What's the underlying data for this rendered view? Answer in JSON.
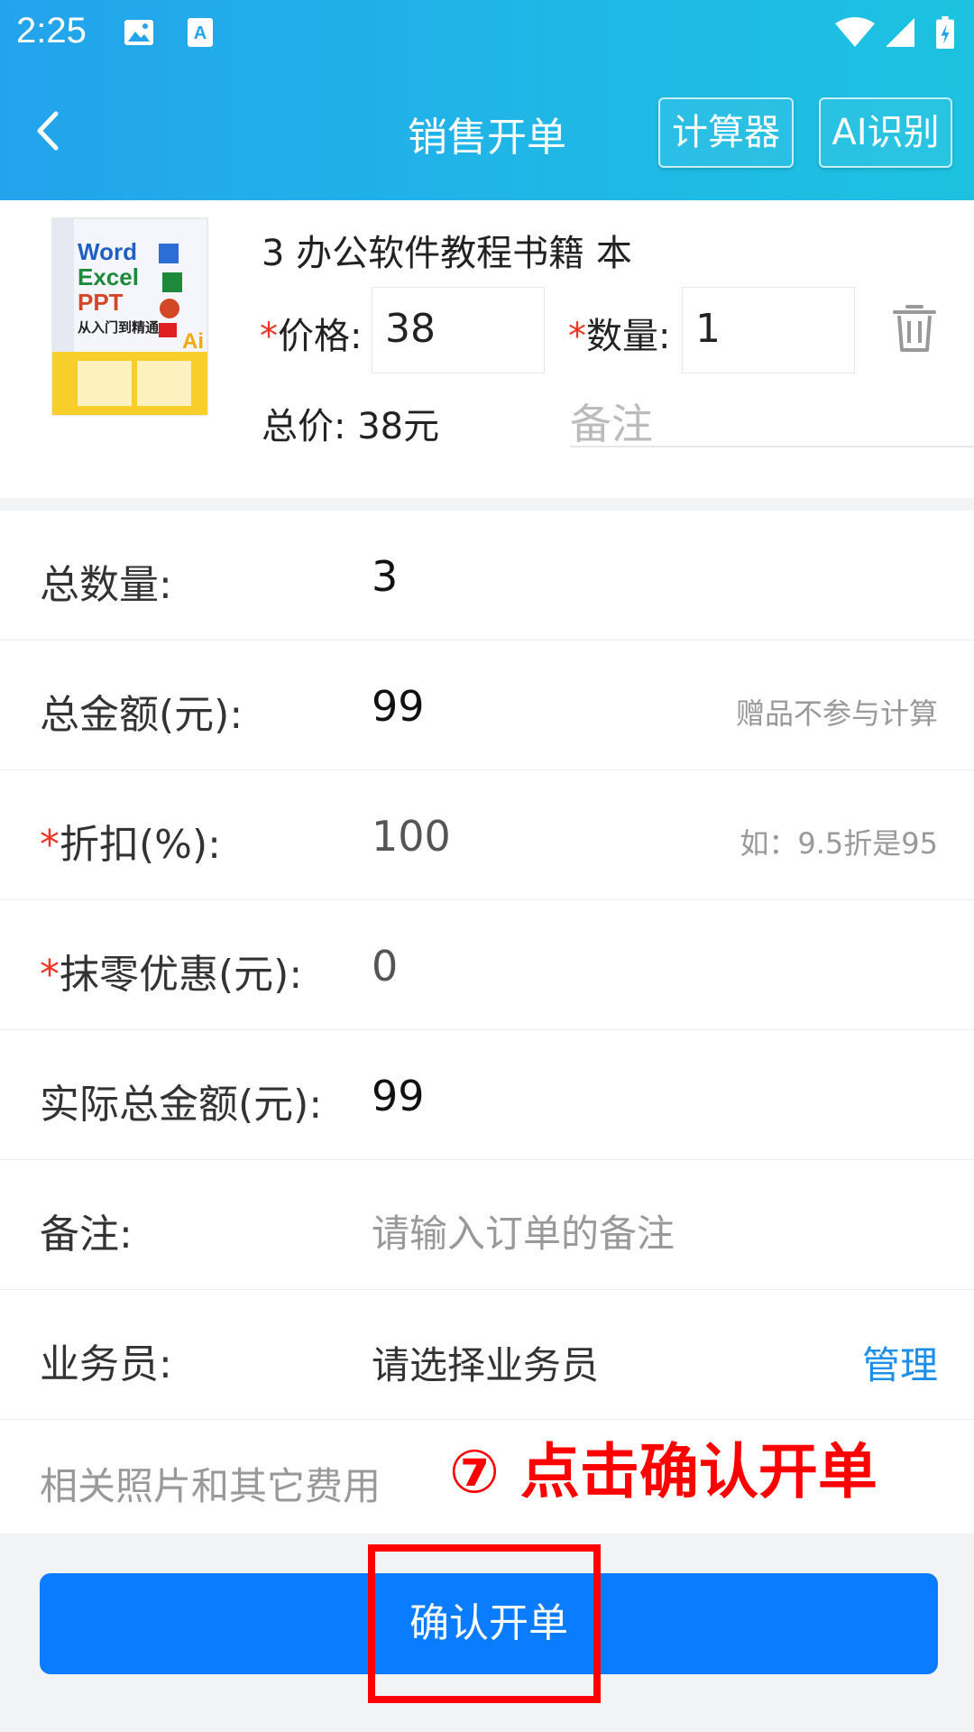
{
  "status_bar": {
    "time": "2:25"
  },
  "header": {
    "title": "销售开单",
    "calculator_label": "计算器",
    "ai_label": "AI识别"
  },
  "product": {
    "name": "3 办公软件教程书籍 本",
    "price_label": "价格:",
    "price_value": "38",
    "qty_label": "数量:",
    "qty_value": "1",
    "required_mark": "*",
    "total_text": "总价: 38元",
    "remark_placeholder": "备注",
    "cover": {
      "line1": "Word",
      "line2": "Excel",
      "line3": "PPT",
      "line4": "从入门到精通"
    }
  },
  "form": {
    "total_qty_label": "总数量:",
    "total_qty_value": "3",
    "total_amount_label": "总金额(元):",
    "total_amount_value": "99",
    "total_amount_hint": "赠品不参与计算",
    "discount_label": "折扣(%):",
    "discount_value": "100",
    "discount_hint": "如：9.5折是95",
    "rounding_label": "抹零优惠(元):",
    "rounding_value": "0",
    "actual_label": "实际总金额(元):",
    "actual_value": "99",
    "note_label": "备注:",
    "note_placeholder": "请输入订单的备注",
    "salesman_label": "业务员:",
    "salesman_value": "请选择业务员",
    "manage_link": "管理",
    "photos_label": "相关照片和其它费用"
  },
  "annotation": "⑦ 点击确认开单",
  "confirm_button": "确认开单",
  "colors": {
    "header_gradient_start": "#23a3ec",
    "header_gradient_end": "#1cc2e0",
    "primary_button": "#0a7cff",
    "link": "#1e8fe8",
    "required": "#e32",
    "annotation": "#ff0000"
  }
}
